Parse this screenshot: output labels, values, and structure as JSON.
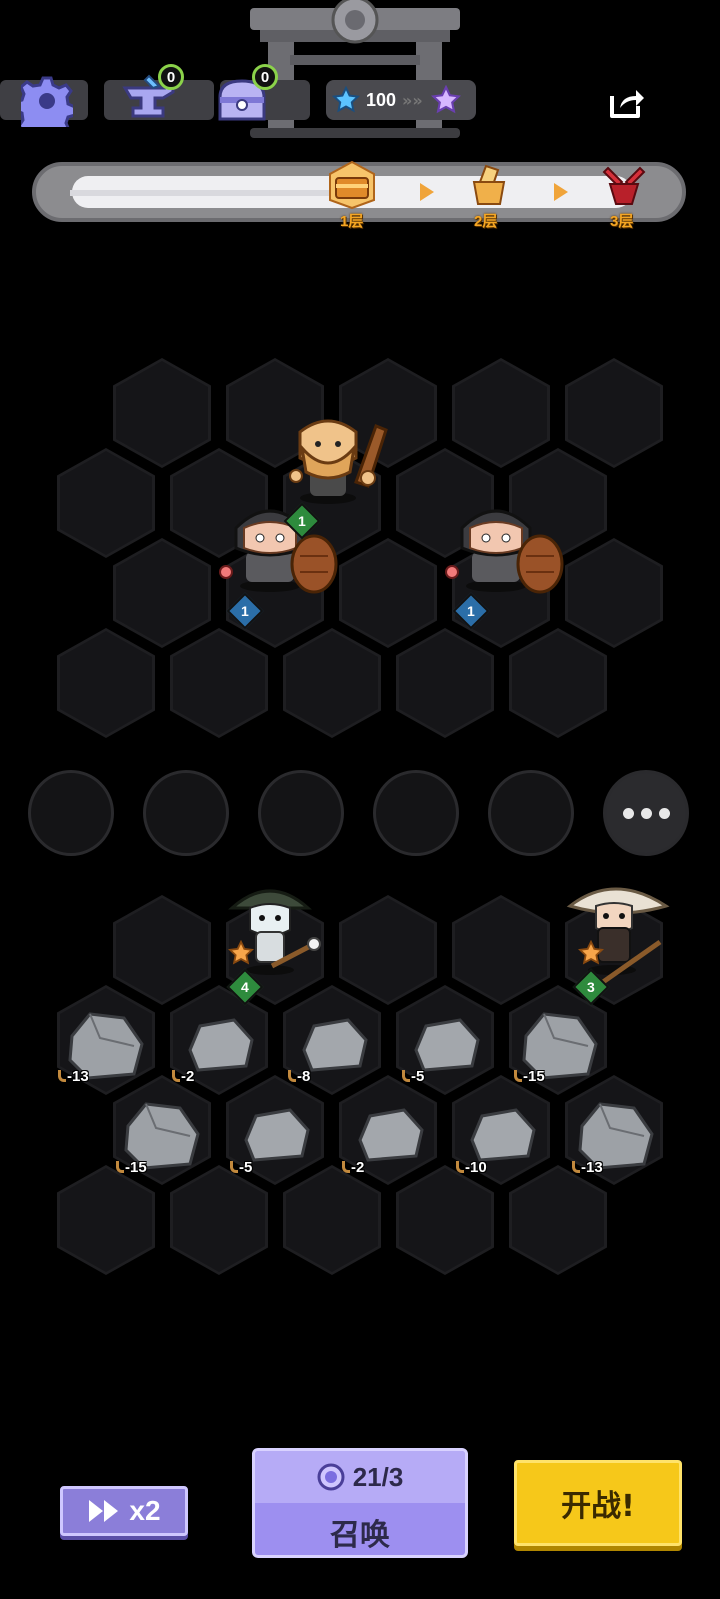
{
  "hud": {
    "anvil_count": "0",
    "chest_count": "0",
    "star_value": "100"
  },
  "progress": {
    "floors": [
      "1层",
      "2层",
      "3层"
    ],
    "current_floor_index": 0
  },
  "enemy_units": [
    {
      "name": "bearded club warrior"
    },
    {
      "name": "shield bandit",
      "level": "1",
      "star": "1"
    },
    {
      "name": "shield bandit",
      "level": "1",
      "star": "1"
    }
  ],
  "player_units": [
    {
      "name": "helmet spear soldier",
      "level": "4"
    },
    {
      "name": "straw hat swordsman",
      "level": "3"
    }
  ],
  "rocks": [
    "-13",
    "-2",
    "-8",
    "-5",
    "-15",
    "-15",
    "-5",
    "-2",
    "-10",
    "-13"
  ],
  "bottom": {
    "speed_label": "x2",
    "summon_count": "21/3",
    "summon_label": "召唤",
    "fight_label": "开战!"
  },
  "colors": {
    "background": "#000000",
    "hex_cell": "#151518",
    "speed_button": "#8b7ed9",
    "summon_button": "#9d8ff0",
    "fight_button": "#f6c81a",
    "floor_label": "#f5a623"
  },
  "icons": [
    "gear-icon",
    "anvil-icon",
    "chest-icon",
    "star-icon",
    "share-icon",
    "fast-forward-icon",
    "summon-orb-icon"
  ]
}
